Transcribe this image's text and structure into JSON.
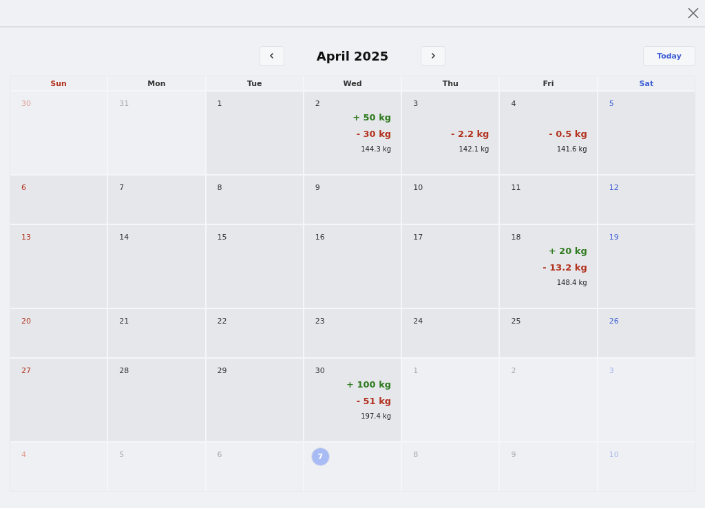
{
  "title": "April 2025",
  "today_button": "Today",
  "weekdays": [
    "Sun",
    "Mon",
    "Tue",
    "Wed",
    "Thu",
    "Fri",
    "Sat"
  ],
  "weeks": [
    {
      "days": [
        {
          "day": "30",
          "outside": true,
          "today": false
        },
        {
          "day": "31",
          "outside": true,
          "today": false
        },
        {
          "day": "1",
          "outside": false,
          "today": false
        },
        {
          "day": "2",
          "outside": false,
          "today": false,
          "entries": [
            {
              "kind": "gain",
              "text": "+ 50 kg"
            },
            {
              "kind": "loss",
              "text": "- 30 kg"
            },
            {
              "kind": "total",
              "text": "144.3 kg"
            }
          ]
        },
        {
          "day": "3",
          "outside": false,
          "today": false,
          "entries": [
            {
              "kind": "loss",
              "text": "- 2.2 kg"
            },
            {
              "kind": "total",
              "text": "142.1 kg"
            }
          ]
        },
        {
          "day": "4",
          "outside": false,
          "today": false,
          "entries": [
            {
              "kind": "loss",
              "text": "- 0.5 kg"
            },
            {
              "kind": "total",
              "text": "141.6 kg"
            }
          ]
        },
        {
          "day": "5",
          "outside": false,
          "today": false
        }
      ]
    },
    {
      "days": [
        {
          "day": "6",
          "outside": false,
          "today": false
        },
        {
          "day": "7",
          "outside": false,
          "today": false
        },
        {
          "day": "8",
          "outside": false,
          "today": false
        },
        {
          "day": "9",
          "outside": false,
          "today": false
        },
        {
          "day": "10",
          "outside": false,
          "today": false
        },
        {
          "day": "11",
          "outside": false,
          "today": false
        },
        {
          "day": "12",
          "outside": false,
          "today": false
        }
      ]
    },
    {
      "days": [
        {
          "day": "13",
          "outside": false,
          "today": false
        },
        {
          "day": "14",
          "outside": false,
          "today": false
        },
        {
          "day": "15",
          "outside": false,
          "today": false
        },
        {
          "day": "16",
          "outside": false,
          "today": false
        },
        {
          "day": "17",
          "outside": false,
          "today": false
        },
        {
          "day": "18",
          "outside": false,
          "today": false,
          "entries": [
            {
              "kind": "gain",
              "text": "+ 20 kg"
            },
            {
              "kind": "loss",
              "text": "- 13.2 kg"
            },
            {
              "kind": "total",
              "text": "148.4 kg"
            }
          ]
        },
        {
          "day": "19",
          "outside": false,
          "today": false
        }
      ]
    },
    {
      "days": [
        {
          "day": "20",
          "outside": false,
          "today": false
        },
        {
          "day": "21",
          "outside": false,
          "today": false
        },
        {
          "day": "22",
          "outside": false,
          "today": false
        },
        {
          "day": "23",
          "outside": false,
          "today": false
        },
        {
          "day": "24",
          "outside": false,
          "today": false
        },
        {
          "day": "25",
          "outside": false,
          "today": false
        },
        {
          "day": "26",
          "outside": false,
          "today": false
        }
      ]
    },
    {
      "days": [
        {
          "day": "27",
          "outside": false,
          "today": false
        },
        {
          "day": "28",
          "outside": false,
          "today": false
        },
        {
          "day": "29",
          "outside": false,
          "today": false
        },
        {
          "day": "30",
          "outside": false,
          "today": false,
          "entries": [
            {
              "kind": "gain",
              "text": "+ 100 kg"
            },
            {
              "kind": "loss",
              "text": "- 51 kg"
            },
            {
              "kind": "total",
              "text": "197.4 kg"
            }
          ]
        },
        {
          "day": "1",
          "outside": true,
          "today": false
        },
        {
          "day": "2",
          "outside": true,
          "today": false
        },
        {
          "day": "3",
          "outside": true,
          "today": false
        }
      ]
    },
    {
      "days": [
        {
          "day": "4",
          "outside": true,
          "today": false
        },
        {
          "day": "5",
          "outside": true,
          "today": false
        },
        {
          "day": "6",
          "outside": true,
          "today": false
        },
        {
          "day": "7",
          "outside": true,
          "today": true
        },
        {
          "day": "8",
          "outside": true,
          "today": false
        },
        {
          "day": "9",
          "outside": true,
          "today": false
        },
        {
          "day": "10",
          "outside": true,
          "today": false
        }
      ]
    }
  ]
}
